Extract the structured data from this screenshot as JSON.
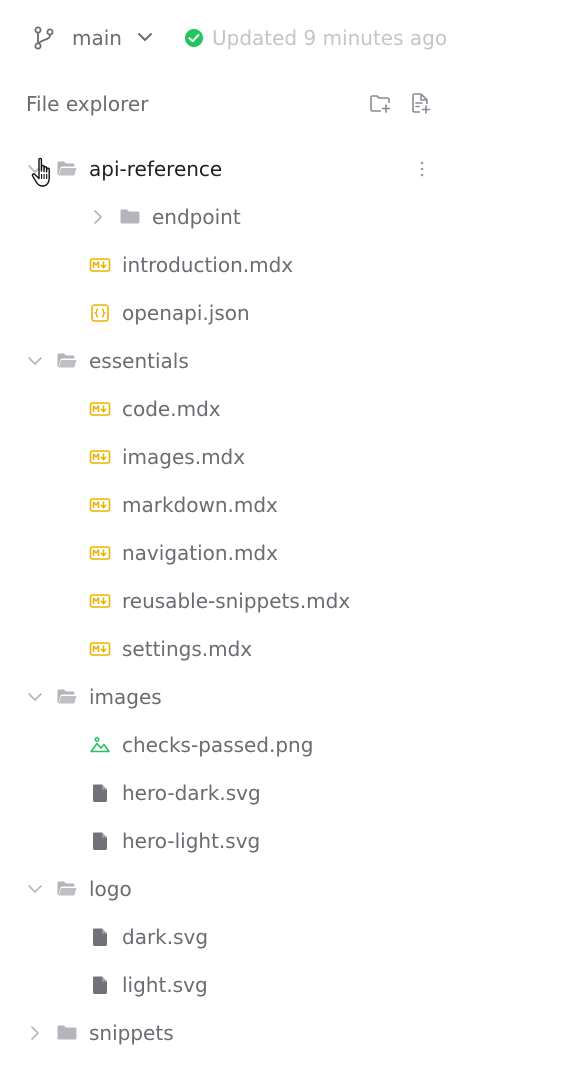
{
  "header": {
    "branch": "main",
    "status": "Updated 9 minutes ago",
    "status_color": "#22c55e"
  },
  "explorer": {
    "title": "File explorer",
    "new_folder_icon": "folder-plus-icon",
    "new_file_icon": "file-plus-icon"
  },
  "colors": {
    "mdx_icon": "#e8b400",
    "json_icon": "#e8b400",
    "png_icon": "#22c55e",
    "svg_icon": "#71717a",
    "folder_icon": "#b4b4ba"
  },
  "tree": [
    {
      "label": "api-reference",
      "type": "folder",
      "expanded": true,
      "depth": 0,
      "active": true
    },
    {
      "label": "endpoint",
      "type": "folder",
      "expanded": false,
      "depth": 1
    },
    {
      "label": "introduction.mdx",
      "type": "mdx",
      "depth": 1
    },
    {
      "label": "openapi.json",
      "type": "json",
      "depth": 1
    },
    {
      "label": "essentials",
      "type": "folder",
      "expanded": true,
      "depth": 0
    },
    {
      "label": "code.mdx",
      "type": "mdx",
      "depth": 1
    },
    {
      "label": "images.mdx",
      "type": "mdx",
      "depth": 1
    },
    {
      "label": "markdown.mdx",
      "type": "mdx",
      "depth": 1
    },
    {
      "label": "navigation.mdx",
      "type": "mdx",
      "depth": 1
    },
    {
      "label": "reusable-snippets.mdx",
      "type": "mdx",
      "depth": 1
    },
    {
      "label": "settings.mdx",
      "type": "mdx",
      "depth": 1
    },
    {
      "label": "images",
      "type": "folder",
      "expanded": true,
      "depth": 0
    },
    {
      "label": "checks-passed.png",
      "type": "png",
      "depth": 1
    },
    {
      "label": "hero-dark.svg",
      "type": "svg",
      "depth": 1
    },
    {
      "label": "hero-light.svg",
      "type": "svg",
      "depth": 1
    },
    {
      "label": "logo",
      "type": "folder",
      "expanded": true,
      "depth": 0
    },
    {
      "label": "dark.svg",
      "type": "svg",
      "depth": 1
    },
    {
      "label": "light.svg",
      "type": "svg",
      "depth": 1
    },
    {
      "label": "snippets",
      "type": "folder",
      "expanded": false,
      "depth": 0
    }
  ]
}
